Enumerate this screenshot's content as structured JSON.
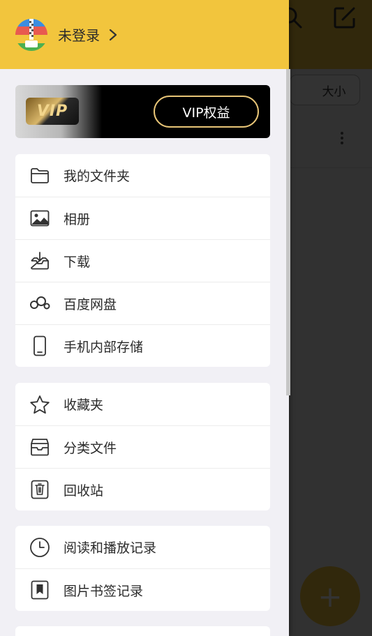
{
  "drawer": {
    "login_text": "未登录",
    "vip_badge": "VIP",
    "vip_button": "VIP权益"
  },
  "groups": [
    {
      "items": [
        {
          "label": "我的文件夹",
          "icon": "folder-icon"
        },
        {
          "label": "相册",
          "icon": "image-icon"
        },
        {
          "label": "下载",
          "icon": "download-icon"
        },
        {
          "label": "百度网盘",
          "icon": "baidu-netdisk-icon"
        },
        {
          "label": "手机内部存储",
          "icon": "phone-icon"
        }
      ]
    },
    {
      "items": [
        {
          "label": "收藏夹",
          "icon": "star-icon"
        },
        {
          "label": "分类文件",
          "icon": "category-box-icon"
        },
        {
          "label": "回收站",
          "icon": "trash-icon"
        }
      ]
    },
    {
      "items": [
        {
          "label": "阅读和播放记录",
          "icon": "clock-icon"
        },
        {
          "label": "图片书签记录",
          "icon": "bookmark-icon"
        }
      ]
    }
  ],
  "background": {
    "sort_button": "大小",
    "fab": "+"
  },
  "colors": {
    "brand_yellow": "#f2c53d",
    "vip_gold": "#e8c577",
    "drawer_bg": "#f1f0f5"
  }
}
